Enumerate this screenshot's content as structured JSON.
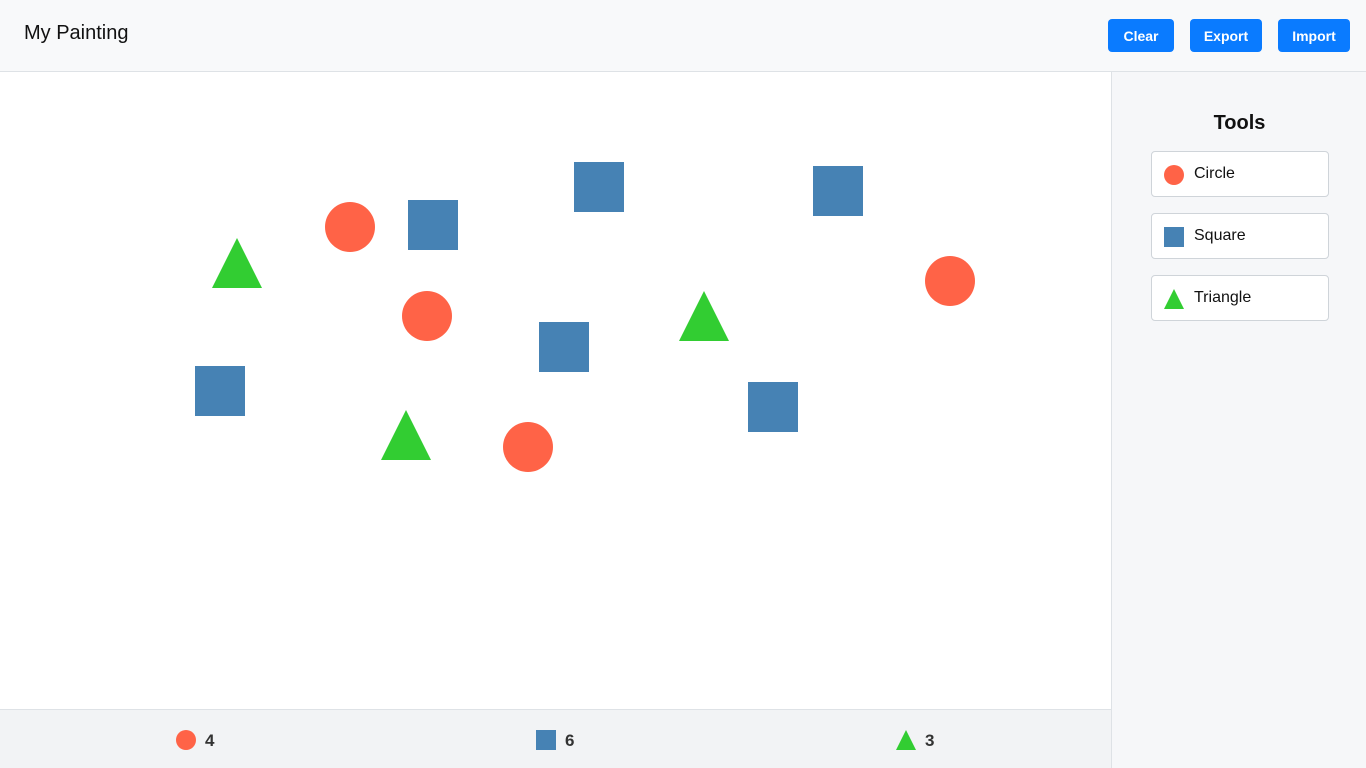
{
  "header": {
    "title": "My Painting",
    "buttons": {
      "clear": "Clear",
      "export": "Export",
      "import": "Import"
    }
  },
  "colors": {
    "circle": "#ff6347",
    "square": "#4682b4",
    "triangle": "#32cd32",
    "button": "#0a7bff"
  },
  "canvas": {
    "circles": 4,
    "squares": 6,
    "triangles": 3
  },
  "sidebar": {
    "title": "Tools",
    "tools": [
      {
        "label": "Circle",
        "icon": "circle-icon"
      },
      {
        "label": "Square",
        "icon": "square-icon"
      },
      {
        "label": "Triangle",
        "icon": "triangle-icon"
      }
    ]
  },
  "footer": {
    "circle_count": "4",
    "square_count": "6",
    "triangle_count": "3"
  }
}
